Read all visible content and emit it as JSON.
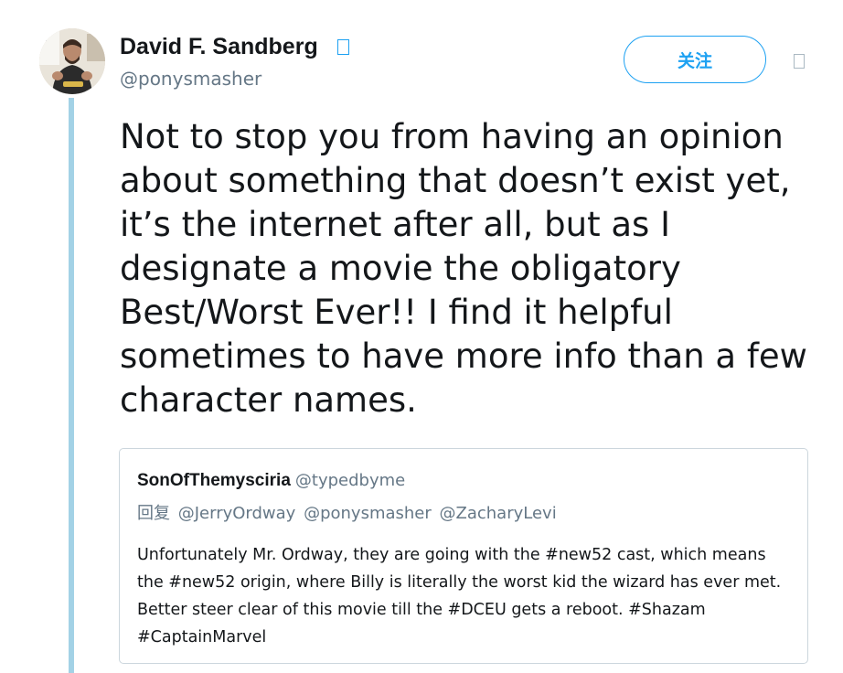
{
  "tweet": {
    "author": {
      "name": "David F. Sandberg",
      "handle": "@ponysmasher",
      "verified_glyph": "□"
    },
    "follow_label": "关注",
    "more_menu_glyph": "□",
    "text": "Not to stop you from having an opinion about something that doesn’t exist yet, it’s the internet after all, but as I designate a movie the obligatory Best/Worst Ever!! I find it helpful sometimes to have more info than a few character names."
  },
  "quoted_tweet": {
    "author_name": "SonOfThemysciria",
    "author_handle": "@typedbyme",
    "reply_prefix": "回复",
    "mentions": [
      "@JerryOrdway",
      "@ponysmasher",
      "@ZacharyLevi"
    ],
    "text": "Unfortunately Mr. Ordway, they are going with the #new52 cast, which means the #new52 origin, where Billy is literally the worst kid the wizard has ever met. Better steer clear of this movie till the #DCEU gets a reboot. #Shazam #CaptainMarvel"
  },
  "colors": {
    "accent": "#1da1f2",
    "thread_line": "#a3d2e6",
    "secondary_text": "#657786",
    "border": "#ccd6dd"
  },
  "icons": {
    "verified": "verified-badge-icon",
    "more": "caret-down-icon"
  }
}
